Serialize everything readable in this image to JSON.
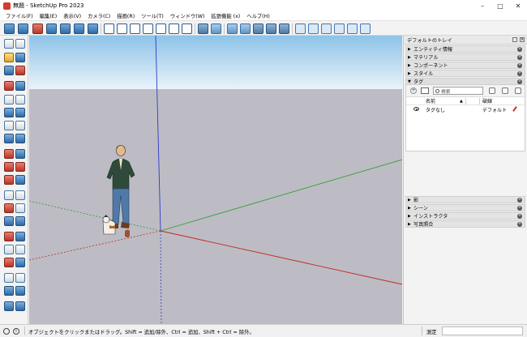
{
  "window": {
    "title": "無題 - SketchUp Pro 2023",
    "controls": [
      "minimize-icon",
      "maximize-icon",
      "close-icon"
    ]
  },
  "menubar": {
    "items": [
      "ファイル(F)",
      "編集(E)",
      "表示(V)",
      "カメラ(C)",
      "描画(R)",
      "ツール(T)",
      "ウィンドウ(W)",
      "拡張機能 (x)",
      "ヘルプ(H)"
    ]
  },
  "toolbar": {
    "groups": [
      "views",
      "styles",
      "sections",
      "solid-tools"
    ]
  },
  "tray": {
    "title": "デフォルトのトレイ",
    "panels_top": [
      {
        "label": "エンティティ情報",
        "expanded": false
      },
      {
        "label": "マテリアル",
        "expanded": false
      },
      {
        "label": "コンポーネント",
        "expanded": false
      },
      {
        "label": "スタイル",
        "expanded": false
      },
      {
        "label": "タグ",
        "expanded": true
      }
    ],
    "tags": {
      "search_placeholder": "検索",
      "col_name": "名前",
      "col_dash": "破線",
      "rows": [
        {
          "name": "タグなし",
          "dash": "デフォルト"
        }
      ]
    },
    "panels_bottom": [
      {
        "label": "影"
      },
      {
        "label": "シーン"
      },
      {
        "label": "インストラクタ"
      },
      {
        "label": "写真照合"
      }
    ]
  },
  "colors": {
    "sky_top": "#8dc3e8",
    "sky_bottom": "#e9f3fa",
    "ground": "#bdbcc4",
    "axis_red": "#c0281e",
    "axis_green": "#2f9b2f",
    "axis_blue": "#2b3cc7"
  },
  "statusbar": {
    "message": "オブジェクトをクリックまたはドラッグ。Shift = 追加/除外、Ctrl = 追加、Shift + Ctrl = 除外。",
    "measure_label": "測定"
  }
}
